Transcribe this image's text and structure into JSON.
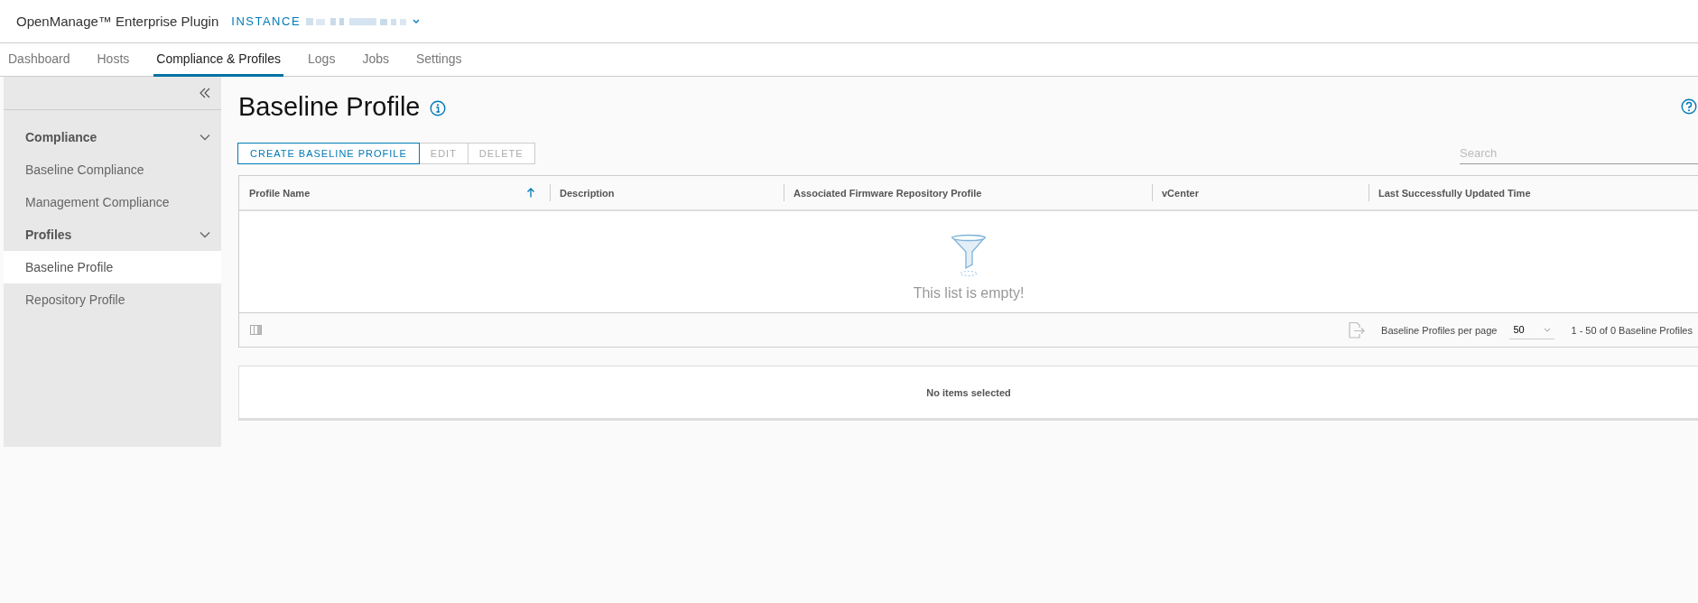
{
  "header": {
    "title": "OpenManage™ Enterprise Plugin",
    "instance_label": "INSTANCE"
  },
  "tabs": [
    {
      "label": "Dashboard",
      "selected": false
    },
    {
      "label": "Hosts",
      "selected": false
    },
    {
      "label": "Compliance & Profiles",
      "selected": true
    },
    {
      "label": "Logs",
      "selected": false
    },
    {
      "label": "Jobs",
      "selected": false
    },
    {
      "label": "Settings",
      "selected": false
    }
  ],
  "sidebar": {
    "groups": [
      {
        "label": "Compliance",
        "expanded": true,
        "items": [
          {
            "label": "Baseline Compliance",
            "selected": false
          },
          {
            "label": "Management Compliance",
            "selected": false
          }
        ]
      },
      {
        "label": "Profiles",
        "expanded": true,
        "items": [
          {
            "label": "Baseline Profile",
            "selected": true
          },
          {
            "label": "Repository Profile",
            "selected": false
          }
        ]
      }
    ]
  },
  "page": {
    "title": "Baseline Profile"
  },
  "actions": [
    {
      "label": "CREATE BASELINE PROFILE",
      "disabled": false
    },
    {
      "label": "EDIT",
      "disabled": true
    },
    {
      "label": "DELETE",
      "disabled": true
    }
  ],
  "search": {
    "placeholder": "Search"
  },
  "table": {
    "columns": [
      {
        "label": "Profile Name",
        "sorted": true
      },
      {
        "label": "Description",
        "sorted": false
      },
      {
        "label": "Associated Firmware Repository Profile",
        "sorted": false
      },
      {
        "label": "vCenter",
        "sorted": false
      },
      {
        "label": "Last Successfully Updated Time",
        "sorted": false
      }
    ],
    "empty_message": "This list is empty!",
    "footer": {
      "page_size_label": "Baseline Profiles per page",
      "page_size": "50",
      "range": "1 - 50 of 0 Baseline Profiles"
    }
  },
  "detail_panel": {
    "message": "No items selected"
  }
}
